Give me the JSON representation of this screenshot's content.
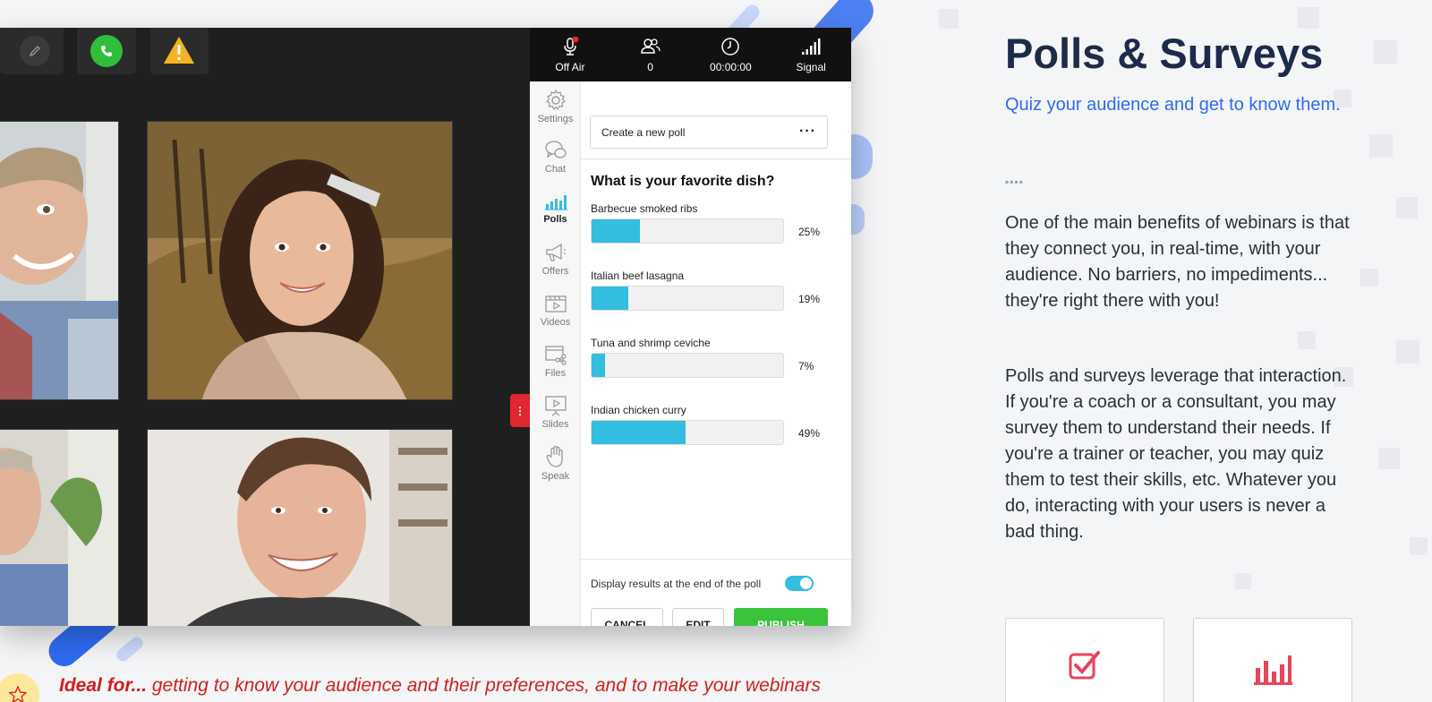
{
  "statusbar": {
    "items": [
      {
        "label": "Off Air",
        "icon": "microphone-icon"
      },
      {
        "label": "0",
        "icon": "attendees-icon"
      },
      {
        "label": "00:00:00",
        "icon": "clock-icon"
      },
      {
        "label": "Signal",
        "icon": "signal-icon"
      }
    ]
  },
  "sidenav": {
    "items": [
      {
        "label": "Settings",
        "icon": "gear-icon"
      },
      {
        "label": "Chat",
        "icon": "chat-icon"
      },
      {
        "label": "Polls",
        "icon": "polls-icon"
      },
      {
        "label": "Offers",
        "icon": "megaphone-icon"
      },
      {
        "label": "Videos",
        "icon": "video-icon"
      },
      {
        "label": "Files",
        "icon": "files-icon"
      },
      {
        "label": "Slides",
        "icon": "slides-icon"
      },
      {
        "label": "Speak",
        "icon": "hand-icon"
      }
    ],
    "active": "Polls"
  },
  "poll": {
    "select_value": "Create a new poll",
    "question": "What is your favorite dish?",
    "options": [
      {
        "label": "Barbecue smoked ribs",
        "percent": "25%",
        "fraction": 0.25
      },
      {
        "label": "Italian beef lasagna",
        "percent": "19%",
        "fraction": 0.19
      },
      {
        "label": "Tuna and shrimp ceviche",
        "percent": "7%",
        "fraction": 0.07
      },
      {
        "label": "Indian chicken curry",
        "percent": "49%",
        "fraction": 0.49
      }
    ],
    "toggle_label": "Display results at the end of the poll",
    "toggle_on": true,
    "buttons": {
      "cancel": "CANCEL",
      "edit": "EDIT",
      "publish": "PUBLISH"
    }
  },
  "colors": {
    "accent_bar": "#33bde0",
    "publish": "#3ac43c",
    "title": "#1e2a4a",
    "subtitle": "#2f6bf0",
    "ideal": "#d0201c"
  },
  "marketing": {
    "title": "Polls & Surveys",
    "subtitle": "Quiz your audience and get to know them.",
    "divider": "▪▪▪▪",
    "paragraph1": "One of the main benefits of webinars is that they connect you, in real-time, with your audience. No barriers, no impediments... they're right there with you!",
    "paragraph2": "Polls and surveys leverage that interaction. If you're a coach or a consultant, you may survey them to understand their needs. If you're a trainer or teacher, you may quiz them to test their skills, etc. Whatever you do, interacting with your users is never a bad thing.",
    "ideal_lead": "Ideal for...",
    "ideal_rest": " getting to know your audience and their preferences, and to make your webinars"
  }
}
